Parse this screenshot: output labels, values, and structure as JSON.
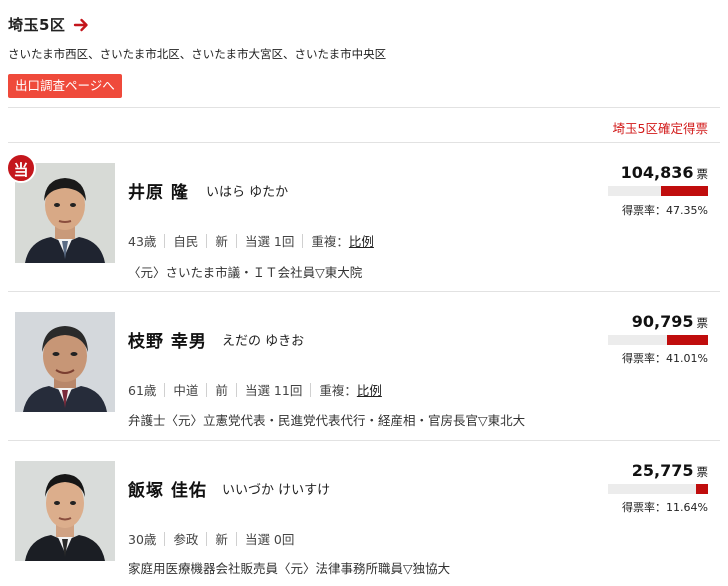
{
  "district": {
    "title": "埼玉5区",
    "arrow_icon": "arrow-right-icon",
    "areas": "さいたま市西区、さいたま市北区、さいたま市大宮区、さいたま市中央区",
    "exit_poll_label": "出口調査ページへ",
    "confirmed_label": "埼玉5区確定得票"
  },
  "colors": {
    "accent": "#c4161c",
    "button": "#ef4a3b",
    "bar": "#c00d0d"
  },
  "candidates": [
    {
      "elected_label": "当",
      "name": "井原 隆",
      "kana": "いはら ゆたか",
      "age": "43歳",
      "party": "自民",
      "status": "新",
      "wins": "当選 1回",
      "dup_label": "重複：",
      "dup_value": "比例",
      "career": "〈元〉さいたま市議・ＩＴ会社員▽東大院",
      "votes": "104,836",
      "unit": "票",
      "rate_text": "得票率：47.35%",
      "rate": 47.35
    },
    {
      "name": "枝野 幸男",
      "kana": "えだの ゆきお",
      "age": "61歳",
      "party": "中道",
      "status": "前",
      "wins": "当選 11回",
      "dup_label": "重複：",
      "dup_value": "比例",
      "career": "弁護士〈元〉立憲党代表・民進党代表代行・経産相・官房長官▽東北大",
      "votes": "90,795",
      "unit": "票",
      "rate_text": "得票率：41.01%",
      "rate": 41.01
    },
    {
      "name": "飯塚 佳佑",
      "kana": "いいづか けいすけ",
      "age": "30歳",
      "party": "参政",
      "status": "新",
      "wins": "当選 0回",
      "career": "家庭用医療機器会社販売員〈元〉法律事務所職員▽独協大",
      "votes": "25,775",
      "unit": "票",
      "rate_text": "得票率：11.64%",
      "rate": 11.64
    }
  ]
}
